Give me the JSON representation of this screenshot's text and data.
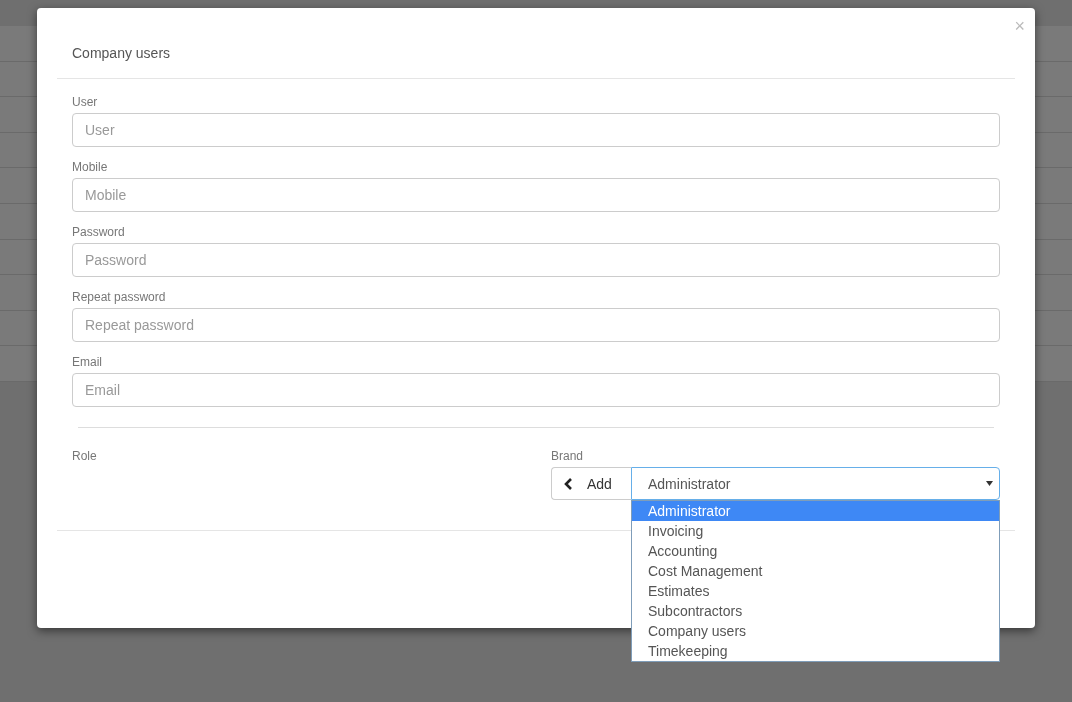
{
  "modal": {
    "title": "Company users",
    "close": "×"
  },
  "fields": [
    {
      "label": "User",
      "placeholder": "User"
    },
    {
      "label": "Mobile",
      "placeholder": "Mobile"
    },
    {
      "label": "Password",
      "placeholder": "Password"
    },
    {
      "label": "Repeat password",
      "placeholder": "Repeat password"
    },
    {
      "label": "Email",
      "placeholder": "Email"
    }
  ],
  "role": {
    "label": "Role"
  },
  "brand": {
    "label": "Brand",
    "add_button": "Add",
    "value": "Administrator",
    "options": [
      {
        "label": "Administrator",
        "selected": true
      },
      {
        "label": "Invoicing",
        "selected": false
      },
      {
        "label": "Accounting",
        "selected": false
      },
      {
        "label": "Cost Management",
        "selected": false
      },
      {
        "label": "Estimates",
        "selected": false
      },
      {
        "label": "Subcontractors",
        "selected": false
      },
      {
        "label": "Company users",
        "selected": false
      },
      {
        "label": "Timekeeping",
        "selected": false
      }
    ]
  }
}
